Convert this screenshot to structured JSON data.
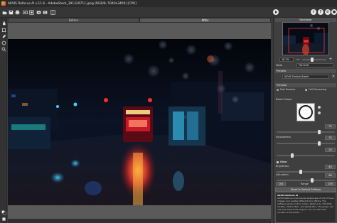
{
  "window": {
    "title": "AKVIS Refocus AI v.11.6 - AdobeStock_391329711.jpeg (RGB/8, 5040x3400) [CPU]"
  },
  "toolbar": {
    "icons": [
      "open-icon",
      "save-icon",
      "print-icon",
      "share-icon",
      "batch-icon",
      "undo-icon",
      "redo-icon",
      "run-icon",
      "about-icon",
      "help-icon",
      "settings-icon",
      "news-icon"
    ]
  },
  "left_tools": [
    "hand-icon",
    "zoom-icon",
    "crop-icon",
    "eraser-icon",
    "brush-icon"
  ],
  "tabs": {
    "before": "Before",
    "after": "After"
  },
  "navigator": {
    "title": "Navigator",
    "zoom_value": "18.7%"
  },
  "mode": {
    "label": "Mode",
    "value": "Tilt-Shift"
  },
  "presets": {
    "label": "Presets",
    "value": "AKVIS Festive Bokeh"
  },
  "preview": {
    "title": "Preview",
    "fast_label": "Fast Preview",
    "full_label": "Full Processing",
    "selected": "Full Processing"
  },
  "bokeh_shape": {
    "label": "Bokeh Shape:"
  },
  "params": {
    "blur_value": "75",
    "smoothness_label": "Smoothness",
    "smoothness_value": "75",
    "radius_value": "25"
  },
  "glow": {
    "title": "Glow",
    "brightness_label": "Brightness",
    "brightness_value": "40",
    "saturation_label": "Saturation",
    "saturation_value": "60",
    "range_label": "Range",
    "range_low": "140",
    "range_high": "255"
  },
  "reset_button": "Reset to Default Settings",
  "about": {
    "title": "AKVIS Refocus AI",
    "text": "AKVIS Refocus AI enhances sharpness of out of focus images and creates different blur effects. The software works in five modes: Refocus AI, Tilt-Shift, Iris Blur, Motion Blur, and Radial Blur. The plugin can use and restore the original. You can also add content to the photo..."
  },
  "colors": {
    "panel_bg": "#3f3f3f",
    "header_bg": "#505050",
    "canvas_bg": "#5a5a5a",
    "accent_red": "#e8343a",
    "accent_cyan": "#35d0e8"
  }
}
